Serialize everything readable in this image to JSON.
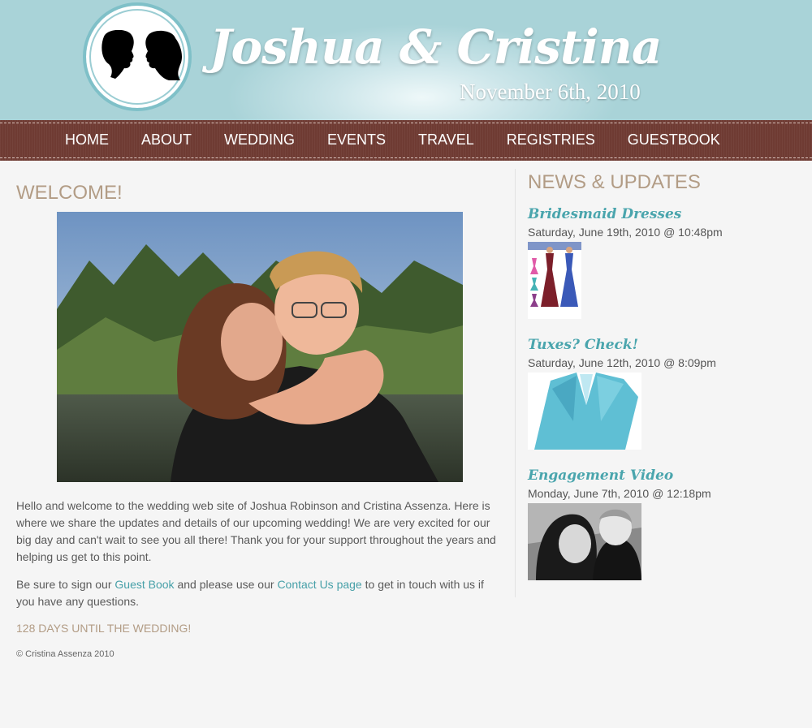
{
  "header": {
    "title": "Joshua & Cristina",
    "date": "November 6th, 2010"
  },
  "nav": {
    "items": [
      "HOME",
      "ABOUT",
      "WEDDING",
      "EVENTS",
      "TRAVEL",
      "REGISTRIES",
      "GUESTBOOK"
    ]
  },
  "main": {
    "heading": "WELCOME!",
    "intro": "Hello and welcome to the wedding web site of Joshua Robinson and Cristina Assenza. Here is where we share the updates and details of our upcoming wedding! We are very excited for our big day and can't wait to see you all there! Thank you for your support throughout the years and helping us get to this point.",
    "p2_before": "Be sure to sign our ",
    "guestbook_link": "Guest Book",
    "p2_middle": " and please use our ",
    "contact_link": "Contact Us page",
    "p2_after": " to get in touch with us if you have any questions.",
    "countdown": "128 DAYS UNTIL THE WEDDING!",
    "copyright": "© Cristina Assenza 2010"
  },
  "sidebar": {
    "heading": "NEWS & UPDATES",
    "items": [
      {
        "title": "Bridesmaid Dresses",
        "date": "Saturday, June 19th, 2010 @ 10:48pm"
      },
      {
        "title": "Tuxes? Check!",
        "date": "Saturday, June 12th, 2010 @ 8:09pm"
      },
      {
        "title": "Engagement Video",
        "date": "Monday, June 7th, 2010 @ 12:18pm"
      }
    ]
  },
  "colors": {
    "header_bg": "#a9d3d8",
    "nav_bg": "#6f3b33",
    "heading_tan": "#b29c85",
    "link_teal": "#47a0a8"
  }
}
